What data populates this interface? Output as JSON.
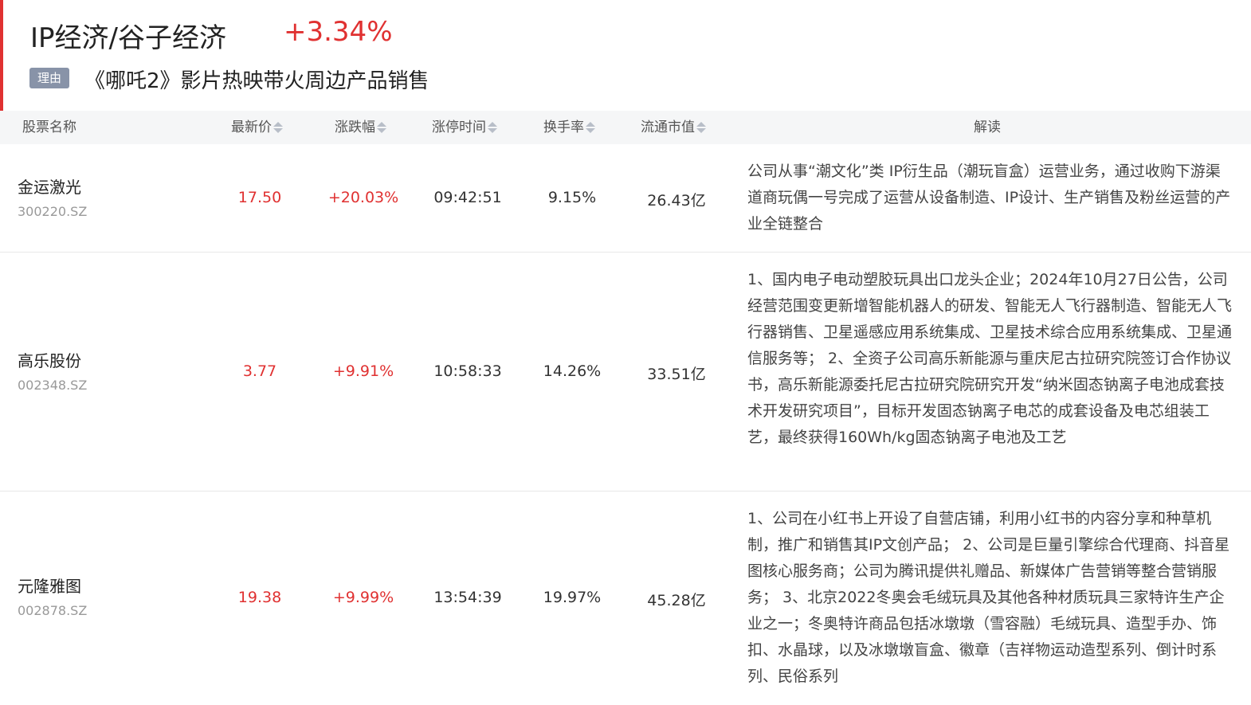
{
  "header": {
    "title": "IP经济/谷子经济",
    "change": "+3.34%",
    "reason_tag": "理由",
    "reason_text": "《哪吒2》影片热映带火周边产品销售"
  },
  "columns": {
    "name": "股票名称",
    "price": "最新价",
    "change": "涨跌幅",
    "limit_time": "涨停时间",
    "turnover": "换手率",
    "float_cap": "流通市值",
    "analysis": "解读"
  },
  "rows": [
    {
      "name": "金运激光",
      "code": "300220.SZ",
      "price": "17.50",
      "change": "+20.03%",
      "limit_time": "09:42:51",
      "turnover": "9.15%",
      "float_cap": "26.43亿",
      "analysis": "公司从事“潮文化”类 IP衍生品（潮玩盲盒）运营业务，通过收购下游渠道商玩偶一号完成了运营从设备制造、IP设计、生产销售及粉丝运营的产业全链整合"
    },
    {
      "name": "高乐股份",
      "code": "002348.SZ",
      "price": "3.77",
      "change": "+9.91%",
      "limit_time": "10:58:33",
      "turnover": "14.26%",
      "float_cap": "33.51亿",
      "analysis": "1、国内电子电动塑胶玩具出口龙头企业；2024年10月27日公告，公司经营范围变更新增智能机器人的研发、智能无人飞行器制造、智能无人飞行器销售、卫星遥感应用系统集成、卫星技术综合应用系统集成、卫星通信服务等； 2、全资子公司高乐新能源与重庆尼古拉研究院签订合作协议书，高乐新能源委托尼古拉研究院研究开发“纳米固态钠离子电池成套技术开发研究项目”，目标开发固态钠离子电芯的成套设备及电芯组装工艺，最终获得160Wh/kg固态钠离子电池及工艺"
    },
    {
      "name": "元隆雅图",
      "code": "002878.SZ",
      "price": "19.38",
      "change": "+9.99%",
      "limit_time": "13:54:39",
      "turnover": "19.97%",
      "float_cap": "45.28亿",
      "analysis": "1、公司在小红书上开设了自营店铺，利用小红书的内容分享和种草机制，推广和销售其IP文创产品； 2、公司是巨量引擎综合代理商、抖音星图核心服务商；公司为腾讯提供礼赠品、新媒体广告营销等整合营销服务； 3、北京2022冬奥会毛绒玩具及其他各种材质玩具三家特许生产企业之一；冬奥特许商品包括冰墩墩（雪容融）毛绒玩具、造型手办、饰扣、水晶球，以及冰墩墩盲盒、徽章（吉祥物运动造型系列、倒计时系列、民俗系列"
    }
  ]
}
